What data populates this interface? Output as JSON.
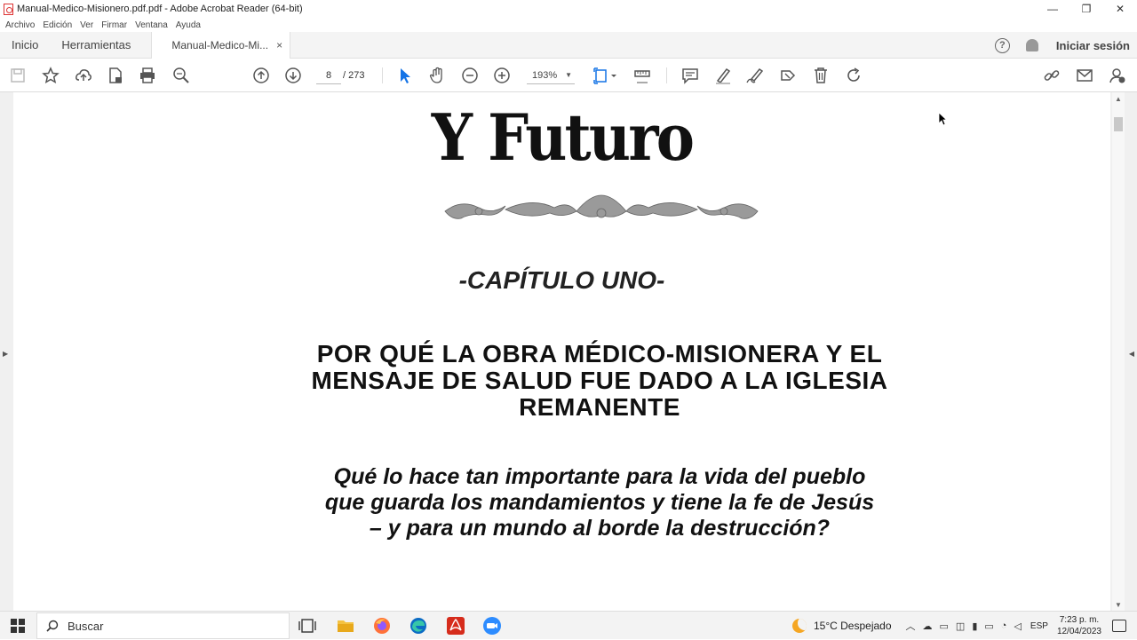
{
  "window": {
    "title": "Manual-Medico-Misionero.pdf.pdf - Adobe Acrobat Reader (64-bit)",
    "minimize": "—",
    "restore": "❐",
    "close": "✕"
  },
  "menu": {
    "items": [
      "Archivo",
      "Edición",
      "Ver",
      "Firmar",
      "Ventana",
      "Ayuda"
    ]
  },
  "tabs": {
    "home": "Inicio",
    "tools": "Herramientas",
    "document": "Manual-Medico-Mi...",
    "close_glyph": "×",
    "help_glyph": "?",
    "signin": "Iniciar sesión"
  },
  "toolbar": {
    "current_page": "8",
    "total_pages": "/ 273",
    "zoom": "193%",
    "zoom_caret": "▼"
  },
  "document": {
    "title": "Y Futuro",
    "chapter": "-CAPÍTULO UNO-",
    "heading_lines": [
      "POR QUÉ LA OBRA MÉDICO-MISIONERA Y EL",
      "MENSAJE DE SALUD FUE DADO A LA IGLESIA",
      "REMANENTE"
    ],
    "question_lines": [
      "Qué lo hace tan importante para la vida del pueblo",
      "que guarda los mandamientos y tiene la fe de Jesús",
      "– y para un mundo al borde la destrucción?"
    ]
  },
  "taskbar": {
    "search_placeholder": "Buscar",
    "weather": "15°C  Despejado",
    "language": "ESP",
    "time": "7:23 p. m.",
    "date": "12/04/2023"
  },
  "colors": {
    "accent_blue": "#1473e6",
    "acrobat_red": "#d62c1c",
    "edge_blue": "#0c6cc4",
    "zoom_blue": "#2d8cff"
  }
}
